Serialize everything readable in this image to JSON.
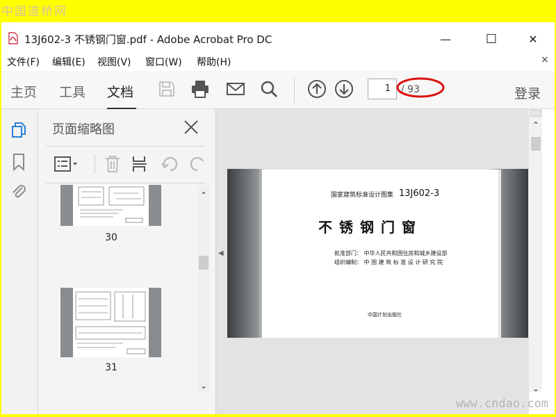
{
  "watermarks": {
    "top": "中国道桥网",
    "bottom": "www.cndao.com"
  },
  "window": {
    "title": "13J602-3 不锈钢门窗.pdf - Adobe Acrobat Pro DC",
    "controls": {
      "minimize": "—",
      "maximize": "☐",
      "close": "✕"
    }
  },
  "menu": {
    "items": [
      "文件(F)",
      "编辑(E)",
      "视图(V)",
      "窗口(W)",
      "帮助(H)"
    ],
    "close": "×"
  },
  "toolbar": {
    "tabs": [
      "主页",
      "工具",
      "文档"
    ],
    "active_tab": "文档",
    "icons": [
      "save-icon",
      "print-icon",
      "email-icon",
      "search-icon",
      "arrow-up-icon",
      "arrow-down-icon"
    ],
    "page_current": "1",
    "page_total": "/ 93",
    "login": "登录"
  },
  "rail": {
    "icons": [
      "pages-icon",
      "bookmark-icon",
      "attachment-icon"
    ]
  },
  "thumb_panel": {
    "title": "页面缩略图",
    "tools": [
      "options-icon",
      "delete-icon",
      "insert-icon",
      "rotate-left-icon",
      "rotate-right-icon"
    ],
    "thumbnails": [
      {
        "label": "30"
      },
      {
        "label": "31"
      }
    ]
  },
  "document": {
    "series": "国家建筑标准设计图集",
    "code": "13J602-3",
    "title": "不锈钢门窗",
    "approval": "批准部门：  中华人民共和国住房和城乡建设部",
    "organizer": "组织编制：  中 国 建 筑 标 准 设 计 研 究 院",
    "publisher": "中国计划出版社"
  },
  "colors": {
    "background": "#ffff00",
    "annotation": "#dd1111",
    "toolbar": "#f7f7f7"
  }
}
